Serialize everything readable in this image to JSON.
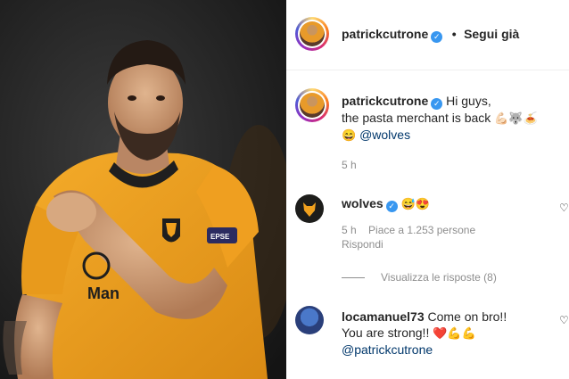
{
  "header": {
    "username": "patrickcutrone",
    "separator": "•",
    "follow_label": "Segui già"
  },
  "post": {
    "username": "patrickcutrone",
    "caption_line1": "Hi guys,",
    "caption_line2": "the pasta merchant is back",
    "caption_emoji1": "💪🏻🐺🍝",
    "caption_emoji2": "😄",
    "mention": "@wolves",
    "time": "5 h"
  },
  "comments": [
    {
      "username": "wolves",
      "text": "😅😍",
      "time": "5 h",
      "likes": "Piace a 1.253 persone",
      "reply_label": "Rispondi"
    },
    {
      "view_replies": "Visualizza le risposte (8)"
    },
    {
      "username": "locamanuel73",
      "text_line1": "Come on bro!!",
      "text_line2": "You are strong!!",
      "emoji": "❤️💪💪",
      "mention": "@patrickcutrone"
    }
  ],
  "photo": {
    "sponsor_text": "Man",
    "badge_text": "EPSE"
  },
  "colors": {
    "jersey": "#f0a11e",
    "verified": "#3897f0",
    "mention": "#00376b"
  }
}
